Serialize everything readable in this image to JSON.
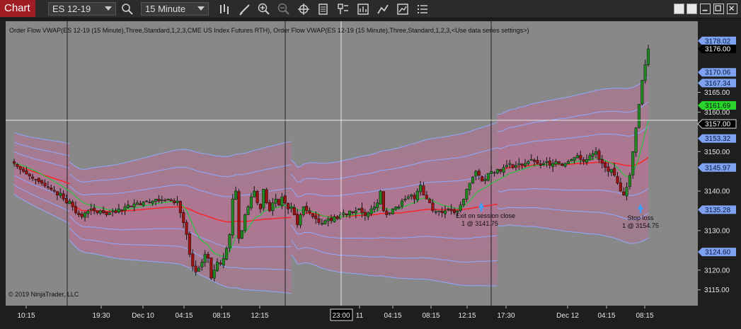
{
  "toolbar": {
    "tab_label": "Chart",
    "instrument": "ES 12-19",
    "interval": "15 Minute",
    "icons": [
      "search-icon",
      "bar-type-icon",
      "drawing-tools-icon",
      "zoom-in-icon",
      "zoom-out-icon",
      "crosshair-icon",
      "data-box-icon",
      "properties-icon",
      "indicators-icon",
      "strategies-icon",
      "templates-icon",
      "chart-trader-icon"
    ]
  },
  "window_controls": [
    "restore-tile-icon",
    "tile-icon",
    "minimize-icon",
    "maximize-icon",
    "close-icon"
  ],
  "chart": {
    "indicator_label": "Order Flow VWAP(ES 12-19 (15 Minute),Three,Standard,1,2,3,CME US Index Futures RTH), Order Flow VWAP(ES 12-19 (15 Minute),Three,Standard,1,2,3,<Use data series settings>)",
    "copyright": "© 2019 NinjaTrader, LLC",
    "colors": {
      "background": "#888888",
      "band_fill": "#cc6f9c",
      "band_line": "#8ea9ff",
      "vwap": "#ff2020",
      "ema": "#23c33a",
      "up_candle": "#1f8a1f",
      "down_candle": "#9e1111",
      "marker": "#3ba0ff"
    },
    "x_ticks": [
      "10:15",
      "19:30",
      "Dec 10",
      "04:15",
      "08:15",
      "12:15",
      "11",
      "04:15",
      "08:15",
      "12:15",
      "17:30",
      "Dec 12",
      "04:15",
      "08:15"
    ],
    "cursor_time": "23:00",
    "cursor_price": "3157.00",
    "y_ticks": [
      "3165.00",
      "3160.00",
      "3150.00",
      "3140.00",
      "3130.00",
      "3120.00",
      "3115.00"
    ],
    "y_labels": [
      {
        "text": "3178.02",
        "kind": "band"
      },
      {
        "text": "3176.00",
        "kind": "last"
      },
      {
        "text": "3170.06",
        "kind": "band"
      },
      {
        "text": "3167.34",
        "kind": "band"
      },
      {
        "text": "3161.69",
        "kind": "green"
      },
      {
        "text": "3157.00",
        "kind": "cursor"
      },
      {
        "text": "3153.32",
        "kind": "band"
      },
      {
        "text": "3145.97",
        "kind": "band"
      },
      {
        "text": "3135.28",
        "kind": "band"
      },
      {
        "text": "3124.60",
        "kind": "band"
      }
    ],
    "annotations": [
      {
        "line1": "Exit on session close",
        "line2": "1 @ 3141.75"
      },
      {
        "line1": "Stop loss",
        "line2": "1 @ 3154.75"
      }
    ]
  },
  "chart_data": {
    "type": "candlestick",
    "title": "",
    "ylim": [
      3111,
      3183
    ],
    "x_ticks": [
      "10:15",
      "19:30",
      "Dec 10",
      "04:15",
      "08:15",
      "12:15",
      "11",
      "04:15",
      "08:15",
      "12:15",
      "17:30",
      "Dec 12",
      "04:15",
      "08:15"
    ],
    "close": [
      3147.0,
      3146.2,
      3145.5,
      3145.0,
      3144.3,
      3143.8,
      3143.2,
      3143.0,
      3142.4,
      3142.0,
      3141.3,
      3141.0,
      3140.4,
      3140.0,
      3139.0,
      3139.5,
      3138.0,
      3137.0,
      3137.5,
      3136.0,
      3134.5,
      3134.0,
      3133.5,
      3134.5,
      3135.0,
      3135.5,
      3135.0,
      3134.5,
      3135.0,
      3134.5,
      3134.0,
      3134.5,
      3135.0,
      3134.5,
      3135.5,
      3135.0,
      3136.0,
      3136.5,
      3136.0,
      3136.8,
      3137.0,
      3136.5,
      3137.2,
      3137.5,
      3137.0,
      3137.5,
      3138.0,
      3137.5,
      3137.8,
      3137.5,
      3138.0,
      3137.5,
      3137.0,
      3137.5,
      3134.5,
      3132.0,
      3129.0,
      3124.0,
      3121.0,
      3119.5,
      3120.5,
      3122.0,
      3124.0,
      3123.0,
      3118.0,
      3120.0,
      3122.0,
      3121.5,
      3123.0,
      3125.5,
      3129.0,
      3138.0,
      3140.0,
      3128.0,
      3130.0,
      3134.0,
      3136.0,
      3138.5,
      3140.0,
      3137.0,
      3135.5,
      3140.5,
      3137.0,
      3135.0,
      3137.0,
      3138.0,
      3136.5,
      3138.5,
      3137.0,
      3135.5,
      3136.0,
      3134.0,
      3131.5,
      3134.0,
      3136.0,
      3135.0,
      3134.5,
      3133.5,
      3133.0,
      3132.0,
      3131.8,
      3132.5,
      3133.0,
      3132.5,
      3133.5,
      3133.0,
      3134.0,
      3134.5,
      3134.0,
      3135.0,
      3134.5,
      3135.0,
      3135.5,
      3134.5,
      3133.8,
      3134.5,
      3135.5,
      3136.0,
      3137.0,
      3140.0,
      3135.0,
      3134.0,
      3134.5,
      3135.5,
      3136.0,
      3136.0,
      3137.5,
      3138.0,
      3138.5,
      3139.0,
      3138.0,
      3140.0,
      3141.5,
      3139.0,
      3138.0,
      3137.0,
      3135.0,
      3134.8,
      3135.0,
      3134.5,
      3135.0,
      3135.5,
      3135.0,
      3134.5,
      3135.0,
      3136.5,
      3138.0,
      3140.5,
      3142.0,
      3143.5,
      3145.0,
      3144.0,
      3142.5,
      3143.0,
      3144.5,
      3145.0,
      3144.5,
      3145.5,
      3145.0,
      3146.0,
      3146.5,
      3147.0,
      3146.0,
      3146.5,
      3147.0,
      3146.5,
      3147.0,
      3147.5,
      3148.0,
      3147.5,
      3147.0,
      3146.5,
      3147.0,
      3147.5,
      3146.5,
      3147.0,
      3147.5,
      3147.0,
      3146.5,
      3147.0,
      3147.5,
      3148.0,
      3148.5,
      3149.0,
      3148.0,
      3147.5,
      3148.0,
      3149.0,
      3149.5,
      3150.0,
      3148.0,
      3147.0,
      3146.0,
      3145.0,
      3145.5,
      3144.0,
      3142.0,
      3140.0,
      3139.0,
      3141.0,
      3144.0,
      3150.0,
      3156.0,
      3162.0,
      3168.0,
      3172.0,
      3176.0
    ]
  }
}
